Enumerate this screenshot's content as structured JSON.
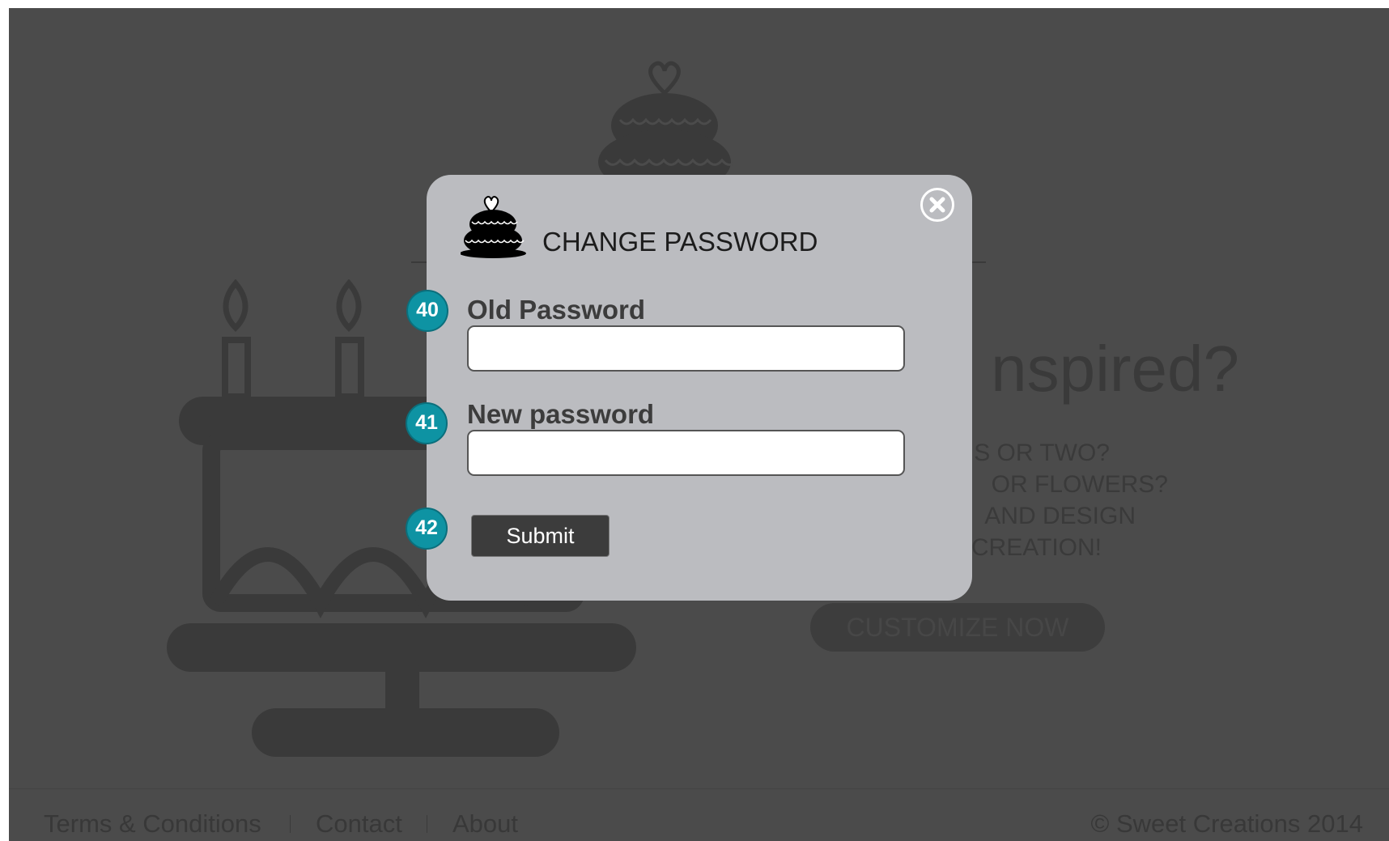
{
  "background": {
    "hero": {
      "heading": "nspired?",
      "lines": [
        "S OR TWO?",
        "OR FLOWERS?",
        "AND DESIGN",
        "CREATION!"
      ],
      "cta_label": "CUSTOMIZE NOW"
    },
    "footer": {
      "links": [
        "Terms & Conditions",
        "Contact",
        "About"
      ],
      "copyright": "© Sweet Creations 2014"
    }
  },
  "modal": {
    "title": "CHANGE PASSWORD",
    "fields": [
      {
        "label": "Old Password",
        "value": "",
        "placeholder": ""
      },
      {
        "label": "New password",
        "value": "",
        "placeholder": ""
      }
    ],
    "submit_label": "Submit"
  },
  "annotations": {
    "badges": [
      "40",
      "41",
      "42"
    ],
    "color": "#0e93a3"
  },
  "colors": {
    "overlay": "#4b4b4b",
    "modal_background": "#bbbcc0",
    "button": "#3c3c3c"
  },
  "icons": {
    "logo": "cake-icon",
    "close": "close-icon"
  }
}
